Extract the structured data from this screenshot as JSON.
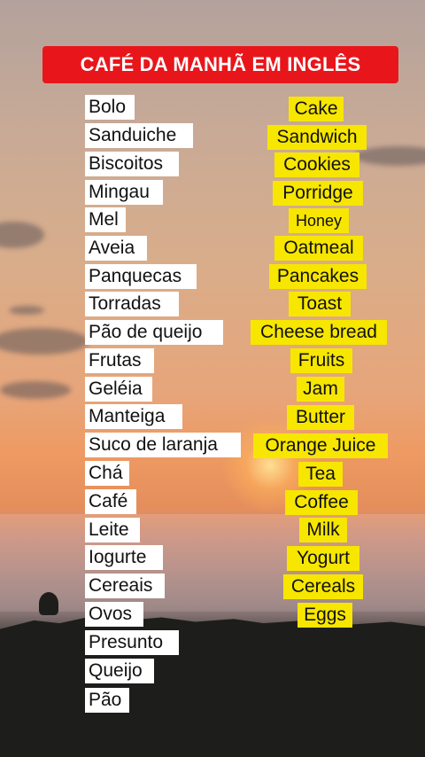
{
  "title": "CAFÉ DA MANHÃ  EM INGLÊS",
  "colors": {
    "title_bg": "#e8161b",
    "portuguese_bg": "#ffffff",
    "english_bg": "#f7e600"
  },
  "portuguese": [
    "Bolo",
    "Sanduiche",
    "Biscoitos",
    "Mingau",
    "Mel",
    "Aveia",
    "Panquecas",
    "Torradas",
    "Pão de queijo",
    "Frutas",
    "Geléia",
    "Manteiga",
    "Suco de laranja",
    "Chá",
    "Café",
    "Leite",
    "Iogurte",
    "Cereais",
    "Ovos",
    "Presunto",
    "Queijo",
    "Pão"
  ],
  "english": [
    "Cake",
    "Sandwich",
    "Cookies",
    "Porridge",
    "Honey",
    "Oatmeal",
    "Pancakes",
    "Toast",
    "Cheese bread",
    "Fruits",
    "Jam",
    "Butter",
    "Orange Juice",
    "Tea",
    "Coffee",
    "Milk",
    "Yogurt",
    "Cereals",
    "Eggs"
  ]
}
